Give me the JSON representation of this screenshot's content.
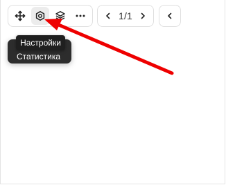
{
  "toolbar": {
    "tools": [
      {
        "icon": "move-icon",
        "active": false
      },
      {
        "icon": "settings-icon",
        "active": true
      },
      {
        "icon": "layers-icon",
        "active": false
      },
      {
        "icon": "more-icon",
        "active": false
      }
    ],
    "pager": {
      "text": "1/1"
    },
    "collapse_icon": "chevron-left-icon"
  },
  "menu_pill": {
    "label": "Статистика"
  },
  "tooltip": {
    "label": "Настройки"
  },
  "annotation": {
    "color": "#ee0000"
  }
}
